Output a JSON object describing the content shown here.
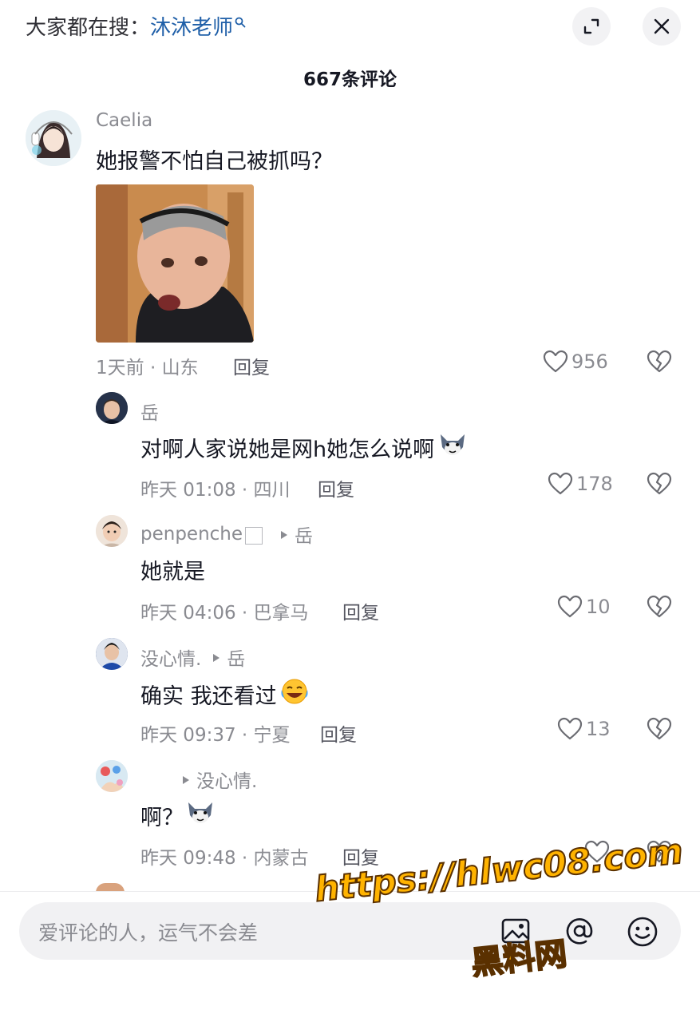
{
  "header": {
    "search_prefix": "大家都在搜：",
    "search_term": "沐沐老师",
    "comment_count": "667条评论"
  },
  "comments": [
    {
      "username": "Caelia",
      "content": "她报警不怕自己被抓吗？",
      "meta": "1天前 · 山东",
      "reply_label": "回复",
      "likes": "956"
    },
    {
      "username": "岳",
      "content": "对啊人家说她是网h她怎么说啊",
      "meta": "昨天 01:08 · 四川",
      "reply_label": "回复",
      "likes": "178"
    },
    {
      "username": "penpenche",
      "reply_to": "岳",
      "content": "她就是",
      "meta": "昨天 04:06 · 巴拿马",
      "reply_label": "回复",
      "likes": "10"
    },
    {
      "username": "没心情.",
      "reply_to": "岳",
      "content": "确实 我还看过",
      "meta": "昨天 09:37 · 宁夏",
      "reply_label": "回复",
      "likes": "13"
    },
    {
      "username": "",
      "reply_to": "没心情.",
      "content": "啊？",
      "meta": "昨天 09:48 · 内蒙古",
      "reply_label": "回复",
      "likes": ""
    }
  ],
  "input": {
    "placeholder": "爱评论的人，运气不会差"
  },
  "watermark": {
    "url": "https://hlwc08.com",
    "name": "黑料网"
  },
  "icons": {
    "expand": "expand-icon",
    "close": "close-icon",
    "search": "search-icon",
    "like": "heart-icon",
    "dislike": "broken-heart-icon",
    "image": "image-icon",
    "mention": "at-icon",
    "emoji": "smiley-icon"
  }
}
